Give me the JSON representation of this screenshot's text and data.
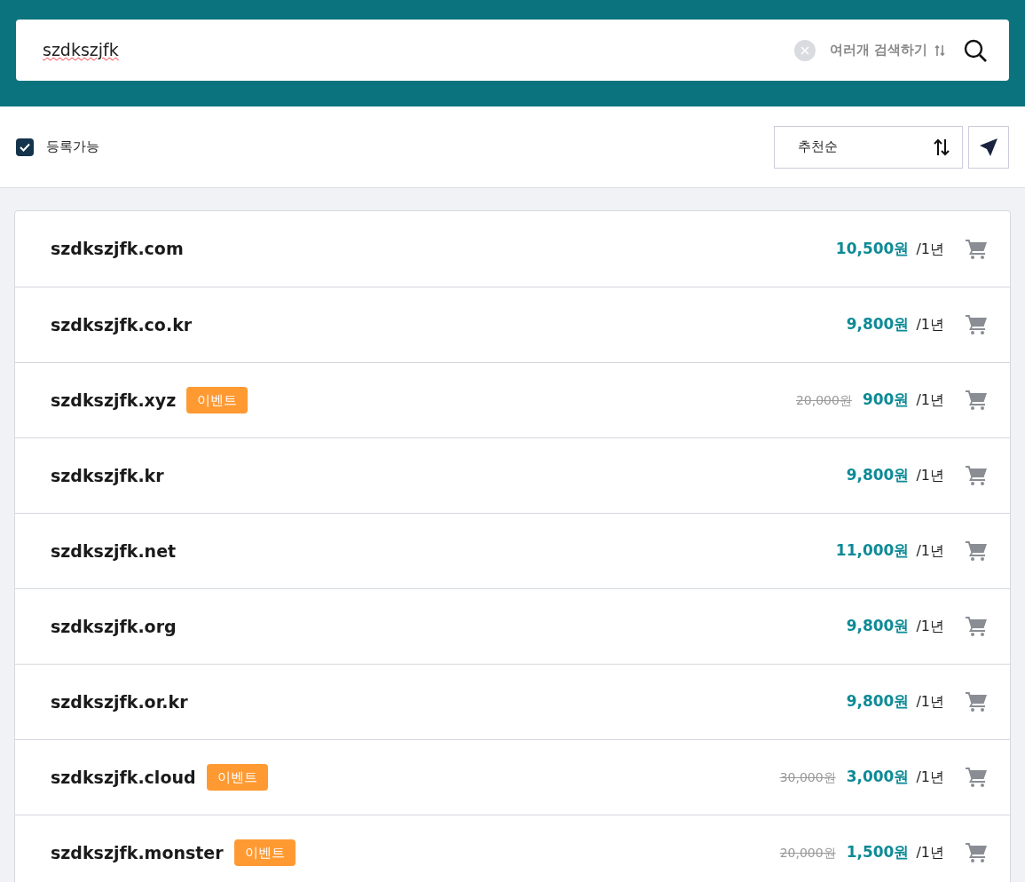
{
  "search": {
    "value": "szdkszjfk",
    "multi_search_label": "여러개 검색하기"
  },
  "filter": {
    "label": "등록가능",
    "checked": true
  },
  "sort": {
    "label": "추천순"
  },
  "results": [
    {
      "domain": "szdkszjfk.com",
      "price": "10,500원",
      "period": "/1년"
    },
    {
      "domain": "szdkszjfk.co.kr",
      "price": "9,800원",
      "period": "/1년"
    },
    {
      "domain": "szdkszjfk.xyz",
      "badge": "이벤트",
      "original_price": "20,000원",
      "price": "900원",
      "period": "/1년"
    },
    {
      "domain": "szdkszjfk.kr",
      "price": "9,800원",
      "period": "/1년"
    },
    {
      "domain": "szdkszjfk.net",
      "price": "11,000원",
      "period": "/1년"
    },
    {
      "domain": "szdkszjfk.org",
      "price": "9,800원",
      "period": "/1년"
    },
    {
      "domain": "szdkszjfk.or.kr",
      "price": "9,800원",
      "period": "/1년"
    },
    {
      "domain": "szdkszjfk.cloud",
      "badge": "이벤트",
      "original_price": "30,000원",
      "price": "3,000원",
      "period": "/1년"
    },
    {
      "domain": "szdkszjfk.monster",
      "badge": "이벤트",
      "original_price": "20,000원",
      "price": "1,500원",
      "period": "/1년"
    }
  ]
}
